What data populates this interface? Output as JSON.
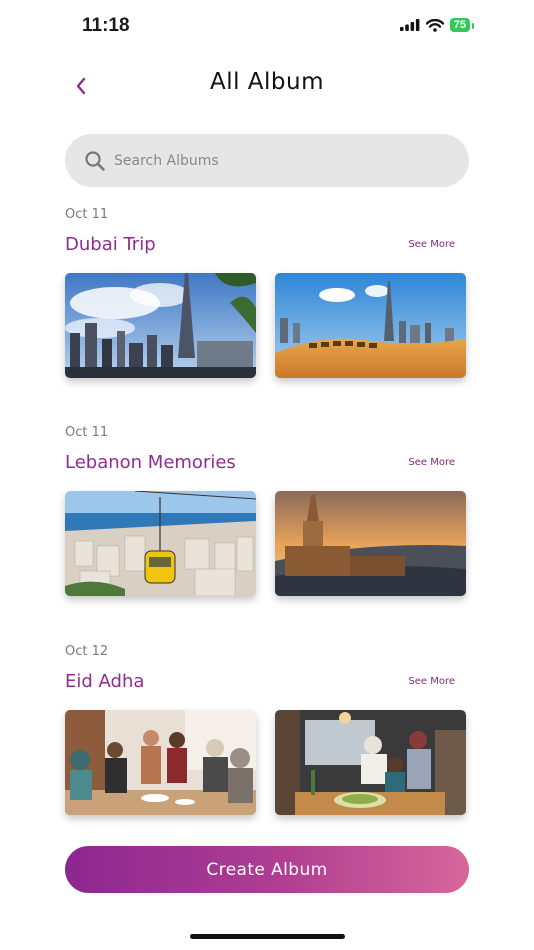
{
  "status_bar": {
    "time": "11:18",
    "battery": "75"
  },
  "header": {
    "title": "All Album"
  },
  "search": {
    "placeholder": "Search Albums"
  },
  "albums": [
    {
      "date": "Oct 11",
      "name": "Dubai Trip",
      "see_more": "See More",
      "photos": [
        "dubai-skyline-photo",
        "dubai-desert-camels-photo"
      ]
    },
    {
      "date": "Oct 11",
      "name": "Lebanon Memories",
      "see_more": "See More",
      "photos": [
        "beirut-cable-car-photo",
        "lebanon-cathedral-sunset-photo"
      ]
    },
    {
      "date": "Oct 12",
      "name": "Eid Adha",
      "see_more": "See More",
      "photos": [
        "eid-family-gathering-photo",
        "eid-family-cooking-photo"
      ]
    }
  ],
  "footer": {
    "create_label": "Create Album"
  },
  "colors": {
    "accent": "#8e2d8e",
    "gradient_start": "#8c2790",
    "gradient_end": "#d7679a"
  }
}
